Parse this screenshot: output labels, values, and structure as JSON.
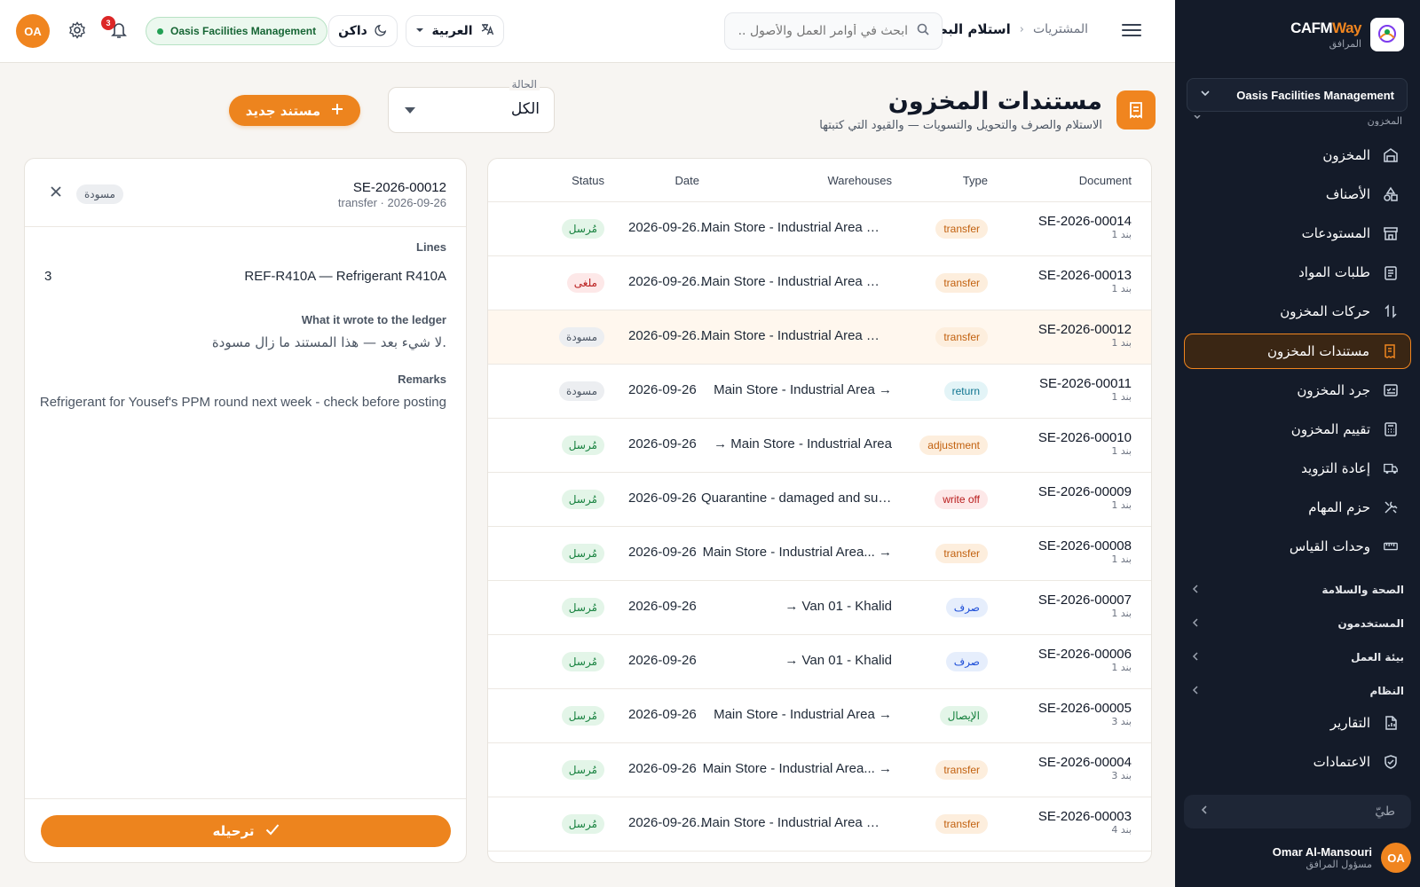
{
  "brand": {
    "name_a": "CAFM",
    "name_b": "Way",
    "sub": "المرافق"
  },
  "sidebar": {
    "org": "Oasis Facilities Management",
    "section_cut": "المخزون",
    "items": [
      {
        "label": "المخزون",
        "icon": "warehouse-icon"
      },
      {
        "label": "الأصناف",
        "icon": "shapes-icon"
      },
      {
        "label": "المستودعات",
        "icon": "store-icon"
      },
      {
        "label": "طلبات المواد",
        "icon": "clipboard-icon"
      },
      {
        "label": "حركات المخزون",
        "icon": "arrows-updown-icon"
      },
      {
        "label": "مستندات المخزون",
        "icon": "receipt-icon",
        "active": true
      },
      {
        "label": "جرد المخزون",
        "icon": "checklist-icon"
      },
      {
        "label": "تقييم المخزون",
        "icon": "calculator-icon"
      },
      {
        "label": "إعادة التزويد",
        "icon": "truck-icon"
      },
      {
        "label": "حزم المهام",
        "icon": "tools-icon"
      },
      {
        "label": "وحدات القياس",
        "icon": "ruler-icon"
      }
    ],
    "groups": [
      "الصحة والسلامة",
      "المستخدمون",
      "بيئة العمل",
      "النظام"
    ],
    "bottom_items": [
      {
        "label": "التقارير",
        "icon": "report-icon"
      },
      {
        "label": "الاعتمادات",
        "icon": "shield-check-icon"
      }
    ],
    "collapse_label": "طيّ",
    "user": {
      "initials": "OA",
      "name": "Omar Al-Mansouri",
      "role": "مسؤول المرافق"
    }
  },
  "topbar": {
    "breadcrumb_parent": "المشتريات",
    "breadcrumb_current": "استلام البضائع",
    "search_placeholder": "ابحث في أوامر العمل والأصول ...",
    "language": "العربية",
    "theme": "داكن",
    "org_badge": "Oasis Facilities Management",
    "notifications": "3",
    "avatar": "OA"
  },
  "page": {
    "title": "مستندات المخزون",
    "subtitle": "الاستلام والصرف والتحويل والتسويات — والقيود التي كتبتها",
    "status_label": "الحالة",
    "status_value": "الكل",
    "new_button": "مستند جديد"
  },
  "table": {
    "headers": {
      "document": "Document",
      "type": "Type",
      "warehouses": "Warehouses",
      "date": "Date",
      "status": "Status"
    },
    "rows": [
      {
        "id": "SE-2026-00014",
        "lines": "1 بند",
        "type": "transfer",
        "warehouses": "Main Store - Industrial Area → V",
        "date": "2026-09-26...",
        "status": "مُرسل"
      },
      {
        "id": "SE-2026-00013",
        "lines": "1 بند",
        "type": "transfer",
        "warehouses": "Main Store - Industrial Area → V",
        "date": "2026-09-26...",
        "status": "ملغى"
      },
      {
        "id": "SE-2026-00012",
        "lines": "1 بند",
        "type": "transfer",
        "warehouses": "Main Store - Industrial Area → V",
        "date": "2026-09-26...",
        "status": "مسودة",
        "selected": true
      },
      {
        "id": "SE-2026-00011",
        "lines": "1 بند",
        "type": "return",
        "warehouses": "Main Store - Industrial Area →",
        "date": "2026-09-26",
        "status": "مسودة"
      },
      {
        "id": "SE-2026-00010",
        "lines": "1 بند",
        "type": "adjustment",
        "warehouses": "→ Main Store - Industrial Area",
        "date": "2026-09-26",
        "status": "مُرسل"
      },
      {
        "id": "SE-2026-00009",
        "lines": "1 بند",
        "type": "write off",
        "warehouses": "Quarantine - damaged and susp...",
        "date": "2026-09-26",
        "status": "مُرسل"
      },
      {
        "id": "SE-2026-00008",
        "lines": "1 بند",
        "type": "transfer",
        "warehouses": "Main Store - Industrial Area... →",
        "date": "2026-09-26",
        "status": "مُرسل"
      },
      {
        "id": "SE-2026-00007",
        "lines": "1 بند",
        "type": "صرف",
        "warehouses": "→ Van 01 - Khalid",
        "date": "2026-09-26",
        "status": "مُرسل"
      },
      {
        "id": "SE-2026-00006",
        "lines": "1 بند",
        "type": "صرف",
        "warehouses": "→ Van 01 - Khalid",
        "date": "2026-09-26",
        "status": "مُرسل"
      },
      {
        "id": "SE-2026-00005",
        "lines": "3 بند",
        "type": "الإيصال",
        "warehouses": "Main Store - Industrial Area →",
        "date": "2026-09-26",
        "status": "مُرسل"
      },
      {
        "id": "SE-2026-00004",
        "lines": "3 بند",
        "type": "transfer",
        "warehouses": "Main Store - Industrial Area... →",
        "date": "2026-09-26",
        "status": "مُرسل"
      },
      {
        "id": "SE-2026-00003",
        "lines": "4 بند",
        "type": "transfer",
        "warehouses": "Main Store - Industrial Area → V",
        "date": "2026-09-26...",
        "status": "مُرسل"
      }
    ]
  },
  "detail": {
    "id": "SE-2026-00012",
    "meta": "transfer · 2026-09-26",
    "status": "مسودة",
    "lines_label": "Lines",
    "line_item": "REF-R410A — Refrigerant R410A",
    "line_qty": "3",
    "ledger_label": "What it wrote to the ledger",
    "ledger_text": "لا شيء بعد — هذا المستند ما زال مسودة.",
    "remarks_label": "Remarks",
    "remarks_text": "Refrigerant for Yousef's PPM round next week - check before posting",
    "post_button": "ترحيله"
  },
  "colors": {
    "accent": "#ed841e",
    "sidebar": "#141b29",
    "posted": "#16a34a",
    "cancelled": "#dc2626",
    "draft": "#4b5563"
  }
}
